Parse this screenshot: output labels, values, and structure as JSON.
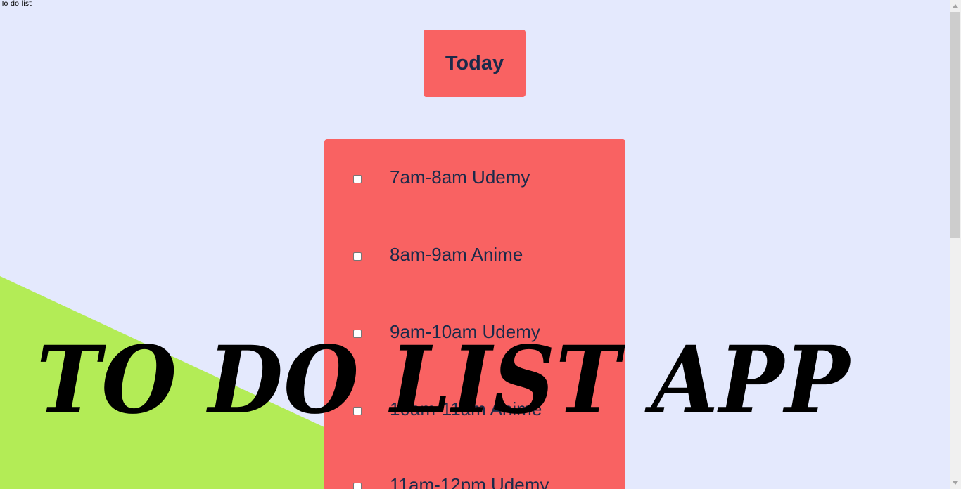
{
  "page": {
    "tab_title": "To do list"
  },
  "heading": {
    "day": "Today"
  },
  "items": [
    {
      "label": "7am-8am Udemy",
      "checked": false
    },
    {
      "label": "8am-9am Anime",
      "checked": false
    },
    {
      "label": "9am-10am Udemy",
      "checked": false
    },
    {
      "label": "10am-11am Anime",
      "checked": false
    },
    {
      "label": "11am-12pm Udemy",
      "checked": false
    }
  ],
  "overlay": {
    "title": "TO DO LIST APP"
  },
  "colors": {
    "background": "#E4E9FD",
    "card": "#F96262",
    "accent_green": "#B3EC56",
    "text": "#1B2A4A"
  },
  "icons": {
    "scroll_up": "scroll-up-arrow-icon",
    "scroll_down": "scroll-down-arrow-icon"
  }
}
